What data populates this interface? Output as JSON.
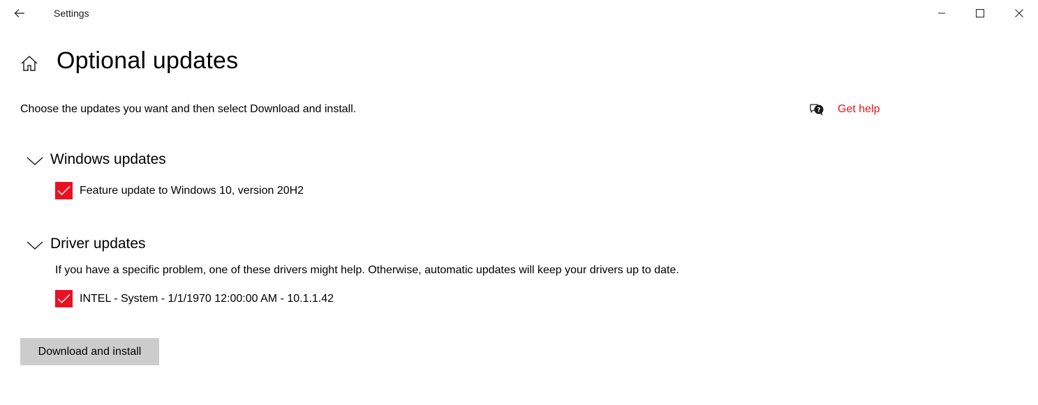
{
  "titlebar": {
    "app_title": "Settings",
    "back_icon": "arrow-left",
    "controls": [
      "minimize",
      "maximize",
      "close"
    ]
  },
  "header": {
    "home_icon": "home",
    "title": "Optional updates"
  },
  "intro": "Choose the updates you want and then select Download and install.",
  "help": {
    "icon": "chat-help",
    "label": "Get help"
  },
  "sections": {
    "windows": {
      "title": "Windows updates",
      "items": [
        {
          "label": "Feature update to Windows 10, version 20H2",
          "checked": true
        }
      ]
    },
    "drivers": {
      "title": "Driver updates",
      "description": "If you have a specific problem, one of these drivers might help. Otherwise, automatic updates will keep your drivers up to date.",
      "items": [
        {
          "label": "INTEL - System - 1/1/1970 12:00:00 AM - 10.1.1.42",
          "checked": true
        }
      ]
    }
  },
  "actions": {
    "download_label": "Download and install"
  },
  "colors": {
    "accent": "#e81123",
    "button_bg": "#cccccc",
    "background": "#ffffff"
  }
}
